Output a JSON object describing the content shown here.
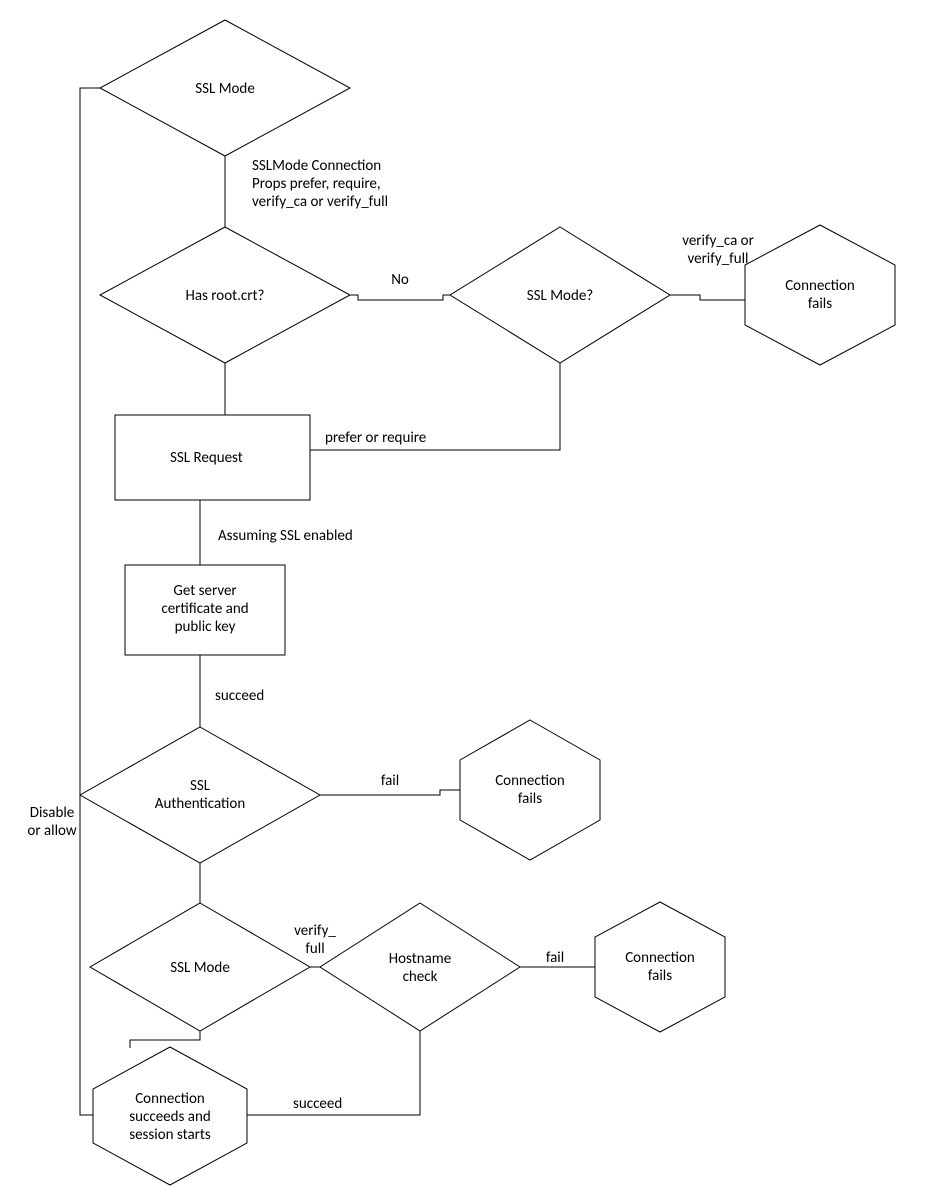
{
  "nodes": {
    "ssl_mode_top": "SSL Mode",
    "has_root_crt": "Has root.crt?",
    "ssl_mode_q": "SSL Mode?",
    "conn_fail_1": "Connection\nfails",
    "ssl_request": "SSL Request",
    "get_cert": "Get server\ncertificate and\npublic key",
    "ssl_auth": "SSL\nAuthentication",
    "conn_fail_2": "Connection\nfails",
    "ssl_mode_bottom": "SSL Mode",
    "hostname_check": "Hostname\ncheck",
    "conn_fail_3": "Connection\nfails",
    "conn_succ": "Connection\nsucceeds and\nsession starts"
  },
  "edges": {
    "disable_or_allow": "Disable\nor allow",
    "sslmode_props": "SSLMode Connection\nProps prefer, require,\nverify_ca or verify_full",
    "no": "No",
    "verify_ca_full": "verify_ca or\nverify_full",
    "prefer_require": "prefer or require",
    "assume_ssl": "Assuming SSL enabled",
    "succeed1": "succeed",
    "fail1": "fail",
    "verify_full": "verify_\nfull",
    "fail2": "fail",
    "succeed2": "succeed"
  }
}
